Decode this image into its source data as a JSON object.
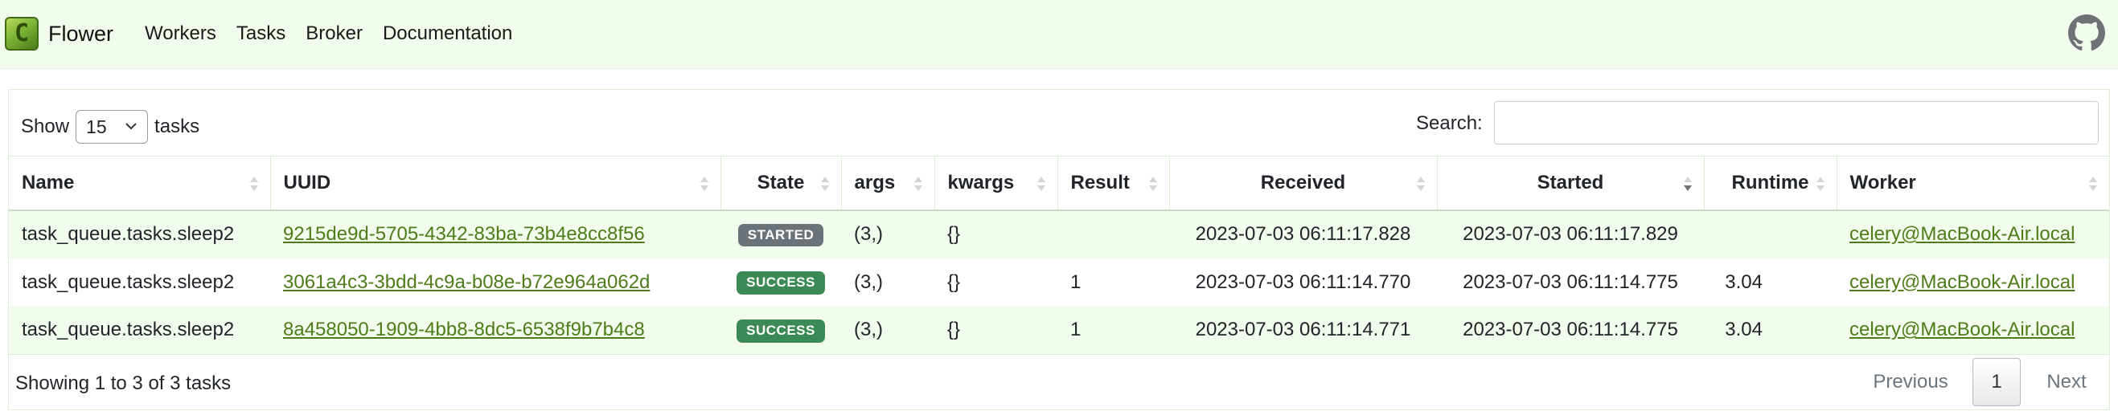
{
  "navbar": {
    "logo_letter": "C",
    "brand": "Flower",
    "links": [
      "Workers",
      "Tasks",
      "Broker",
      "Documentation"
    ],
    "github_icon": "github-icon"
  },
  "controls": {
    "show_label": "Show",
    "page_size": "15",
    "tasks_label": "tasks",
    "search_label": "Search:",
    "search_value": ""
  },
  "table": {
    "columns": [
      "Name",
      "UUID",
      "State",
      "args",
      "kwargs",
      "Result",
      "Received",
      "Started",
      "Runtime",
      "Worker"
    ],
    "sorted_column": "Started",
    "rows": [
      {
        "name": "task_queue.tasks.sleep2",
        "uuid": "9215de9d-5705-4342-83ba-73b4e8cc8f56",
        "state": "STARTED",
        "args": "(3,)",
        "kwargs": "{}",
        "result": "",
        "received": "2023-07-03 06:11:17.828",
        "started": "2023-07-03 06:11:17.829",
        "runtime": "",
        "worker": "celery@MacBook-Air.local"
      },
      {
        "name": "task_queue.tasks.sleep2",
        "uuid": "3061a4c3-3bdd-4c9a-b08e-b72e964a062d",
        "state": "SUCCESS",
        "args": "(3,)",
        "kwargs": "{}",
        "result": "1",
        "received": "2023-07-03 06:11:14.770",
        "started": "2023-07-03 06:11:14.775",
        "runtime": "3.04",
        "worker": "celery@MacBook-Air.local"
      },
      {
        "name": "task_queue.tasks.sleep2",
        "uuid": "8a458050-1909-4bb8-8dc5-6538f9b7b4c8",
        "state": "SUCCESS",
        "args": "(3,)",
        "kwargs": "{}",
        "result": "1",
        "received": "2023-07-03 06:11:14.771",
        "started": "2023-07-03 06:11:14.775",
        "runtime": "3.04",
        "worker": "celery@MacBook-Air.local"
      }
    ]
  },
  "footer": {
    "info": "Showing 1 to 3 of 3 tasks",
    "previous": "Previous",
    "current_page": "1",
    "next": "Next"
  },
  "colors": {
    "navbar_bg": "#f1fcec",
    "link": "#4d7c18",
    "started_badge": "#6b7378",
    "success_badge": "#3b8a55"
  }
}
